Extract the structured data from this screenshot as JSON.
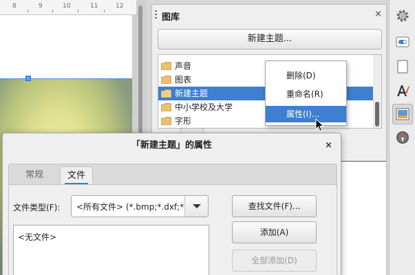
{
  "ruler": {
    "marks": [
      "8",
      "9",
      "10",
      "11",
      "12"
    ]
  },
  "gallery": {
    "title": "图库",
    "close_glyph": "×",
    "new_theme_label": "新建主题...",
    "themes": [
      {
        "label": "声音",
        "selected": false
      },
      {
        "label": "图表",
        "selected": false
      },
      {
        "label": "新建主题",
        "selected": true
      },
      {
        "label": "中小学校及大学",
        "selected": false
      },
      {
        "label": "字形",
        "selected": false
      }
    ]
  },
  "context_menu": {
    "items": [
      {
        "label": "删除(D)",
        "hover": false
      },
      {
        "label": "重命名(R)",
        "hover": false
      },
      {
        "label": "属性(I)...",
        "hover": true
      }
    ]
  },
  "sidebar_deck": {
    "buttons": [
      "gear-icon",
      "properties-icon",
      "page-icon",
      "styles-icon",
      "gallery-icon",
      "navigator-icon"
    ],
    "active": "gallery-icon"
  },
  "dialog": {
    "title": "「新建主题」的属性",
    "close_glyph": "×",
    "tabs": [
      {
        "label": "常规",
        "active": false
      },
      {
        "label": "文件",
        "active": true
      }
    ],
    "file_type_label": "文件类型(F):",
    "file_type_value": "<所有文件> (*.bmp;*.dxf;*.emf;*.eps;*.gif;*.jpg)",
    "file_list_empty": "<无文件>",
    "buttons": {
      "find": "查找文件(F)...",
      "add": "添加(A)",
      "add_all": "全部添加(D)"
    }
  },
  "colors": {
    "accent": "#3d7fd1",
    "panel_bg": "#efefef",
    "folder": "#e8c070"
  }
}
